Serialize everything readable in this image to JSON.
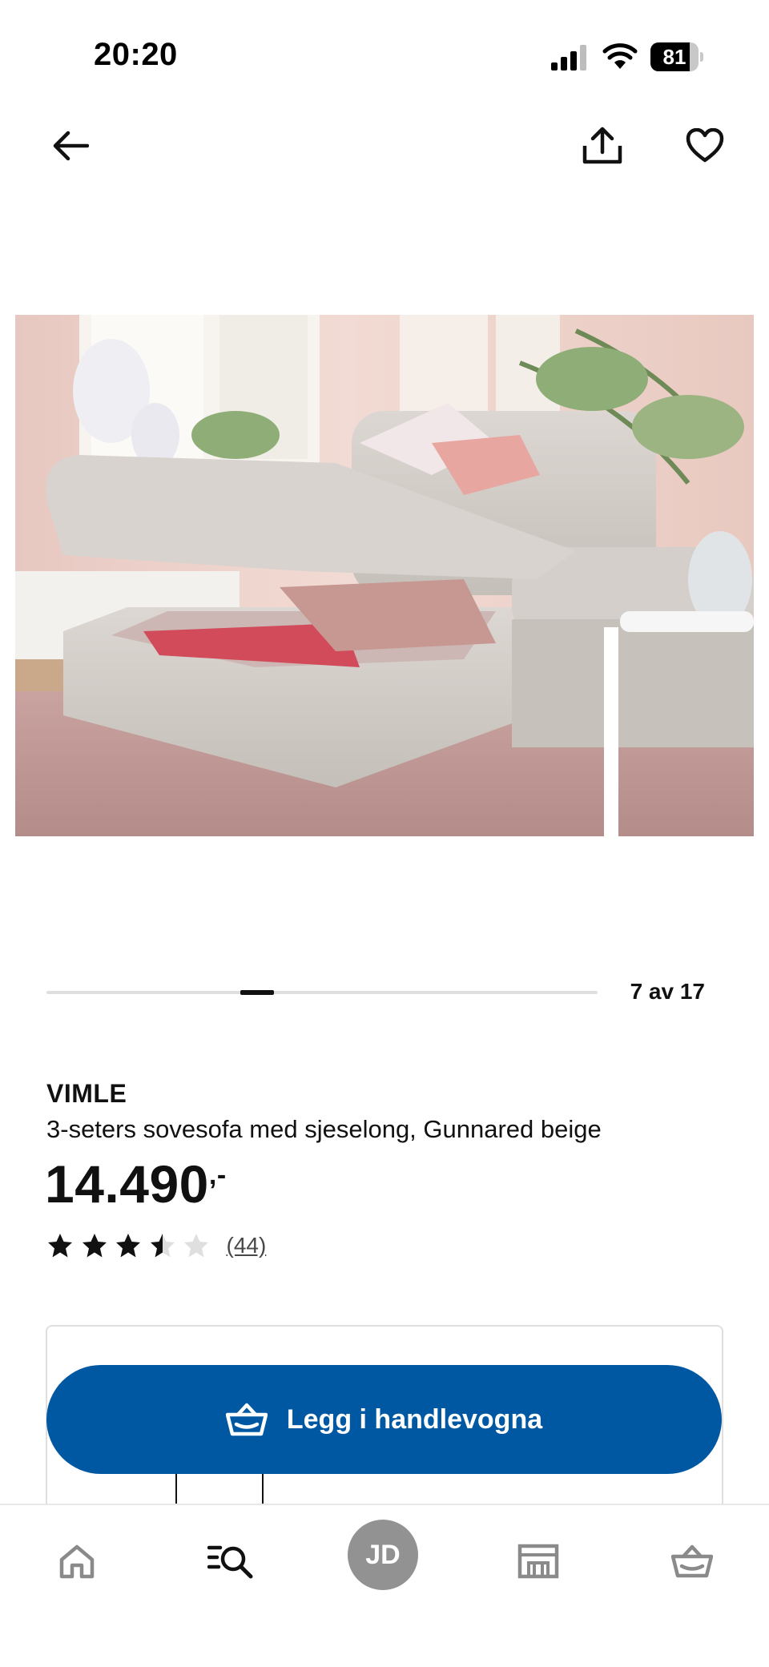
{
  "status_bar": {
    "time": "20:20",
    "battery_level": "81",
    "battery_fraction": 0.81,
    "icons": [
      "signal-icon",
      "wifi-icon",
      "battery-icon"
    ]
  },
  "top_nav": {
    "icons": [
      "arrow-left-icon",
      "share-icon",
      "heart-icon"
    ]
  },
  "gallery": {
    "counter": "7 av 17",
    "current": 7,
    "total": 17
  },
  "product": {
    "brand": "VIMLE",
    "description": "3-seters sovesofa med sjeselong, Gunnared beige",
    "price": "14.490",
    "price_suffix": ",-",
    "rating": 3.5,
    "rating_max": 5,
    "review_count": "(44)"
  },
  "cart_button": {
    "label": "Legg i handlevogna",
    "icon": "shopping-basket-icon"
  },
  "bottom_nav": {
    "profile_initials": "JD",
    "icons": [
      "home-icon",
      "search-list-icon",
      "profile-avatar",
      "store-icon",
      "basket-icon"
    ]
  },
  "colors": {
    "brand_blue": "#0058a3",
    "text": "#111111",
    "avatar_gray": "#929292"
  }
}
